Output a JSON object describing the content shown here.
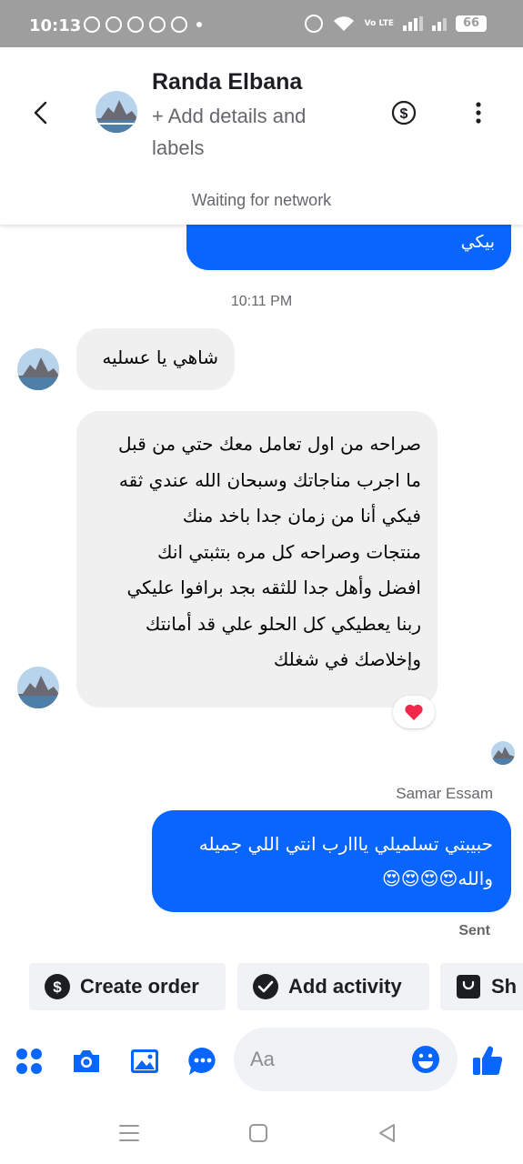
{
  "status_bar": {
    "time": "10:13",
    "network": "Vo LTE",
    "battery": "66"
  },
  "header": {
    "contact_name": "Randa Elbana",
    "add_details": "+ Add details and labels",
    "network_status": "Waiting for network"
  },
  "messages": {
    "outgoing_top": "بيكي",
    "timestamp": "10:11 PM",
    "incoming_short": "شاهي يا عسليه",
    "incoming_long": "صراحه من اول تعامل معك حتي من قبل\nما اجرب مناجاتك وسبحان الله عندي ثقه\nفيكي أنا من زمان جدا باخد منك\nمنتجات وصراحه كل مره بتثبتي انك\nافضل وأهل جدا للثقه بجد برافوا عليكي\nربنا يعطيكي كل الحلو علي قد أمانتك\nوإخلاصك في شغلك",
    "reaction": "❤️",
    "sender_name": "Samar Essam",
    "outgoing_last": "حبيبتي تسلميلي يااارب انتي اللي جميله\nوالله😍😍😍😍",
    "sent_status": "Sent"
  },
  "quick_actions": [
    {
      "label": "Create order",
      "icon": "dollar-circle-icon"
    },
    {
      "label": "Add activity",
      "icon": "check-circle-icon"
    },
    {
      "label": "Sh",
      "icon": "shop-bag-icon"
    }
  ],
  "composer": {
    "placeholder": "Aa",
    "value": ""
  },
  "colors": {
    "accent": "#0866ff",
    "incoming_bubble": "#f0f0f0",
    "status_bar": "#9e9e9e",
    "secondary_text": "#65676b"
  }
}
